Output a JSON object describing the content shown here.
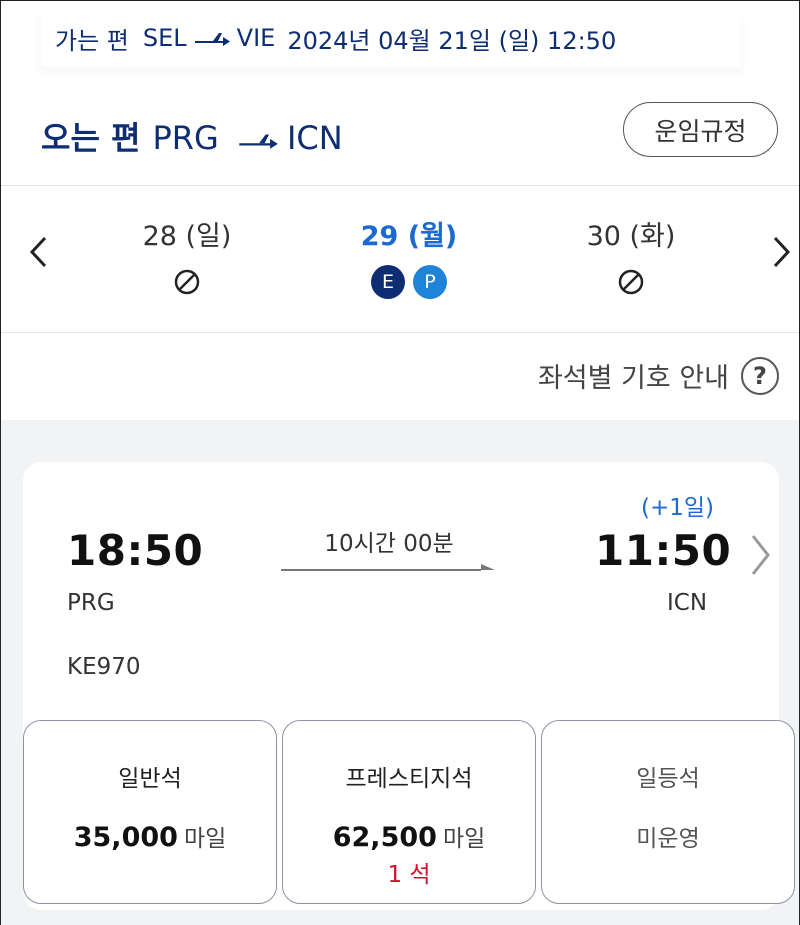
{
  "outbound": {
    "label": "가는 편",
    "origin": "SEL",
    "destination": "VIE",
    "datetime": "2024년 04월 21일 (일) 12:50"
  },
  "return_header": {
    "title": "오는 편",
    "origin": "PRG",
    "destination": "ICN",
    "fare_rules_label": "운임규정"
  },
  "date_strip": {
    "dates": [
      {
        "label": "28 (일)",
        "status": "no-flight"
      },
      {
        "label": "29 (월)",
        "status": "available",
        "badges": [
          "E",
          "P"
        ]
      },
      {
        "label": "30 (화)",
        "status": "no-flight"
      }
    ]
  },
  "legend": {
    "label": "좌석별 기호 안내",
    "help_glyph": "?"
  },
  "flight": {
    "plus_day": "(+1일)",
    "departure_time": "18:50",
    "arrival_time": "11:50",
    "departure_airport": "PRG",
    "arrival_airport": "ICN",
    "duration": "10시간 00분",
    "flight_number": "KE970"
  },
  "cabins": [
    {
      "name": "일반석",
      "price": "35,000",
      "unit": "마일",
      "seats": ""
    },
    {
      "name": "프레스티지석",
      "price": "62,500",
      "unit": "마일",
      "seats": "1 석"
    },
    {
      "name": "일등석",
      "status": "미운영"
    }
  ],
  "colors": {
    "navy": "#0e2d72",
    "accent_blue": "#1a6ad1",
    "badge_p": "#1f84d8",
    "seat_alert_red": "#d0112b"
  }
}
